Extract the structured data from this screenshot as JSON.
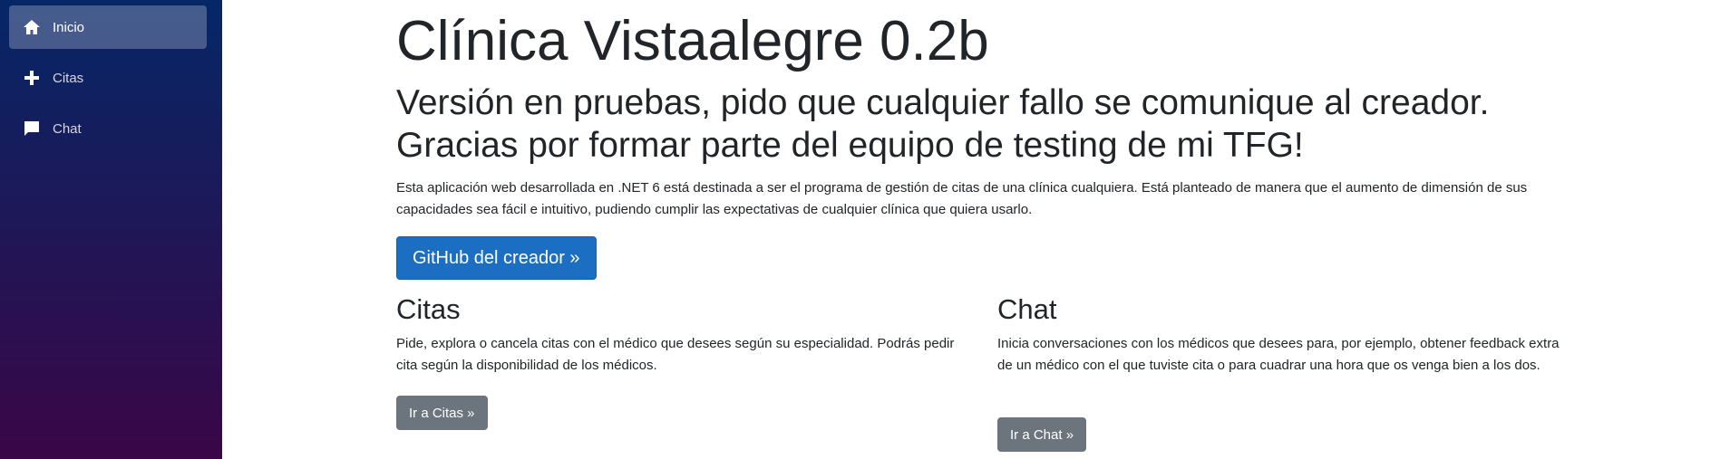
{
  "sidebar": {
    "items": [
      {
        "label": "Inicio",
        "icon": "home-icon",
        "active": true
      },
      {
        "label": "Citas",
        "icon": "plus-icon",
        "active": false
      },
      {
        "label": "Chat",
        "icon": "chat-icon",
        "active": false
      }
    ],
    "gradient": [
      "#052767",
      "#3a0647"
    ]
  },
  "main": {
    "title": "Clínica Vistaalegre 0.2b",
    "lead": "Versión en pruebas, pido que cualquier fallo se comunique al creador. Gracias por formar parte del equipo de testing de mi TFG!",
    "description": "Esta aplicación web desarrollada en .NET 6 está destinada a ser el programa de gestión de citas de una clínica cualquiera. Está planteado de manera que el aumento de dimensión de sus capacidades sea fácil e intuitivo, pudiendo cumplir las expectativas de cualquier clínica que quiera usarlo.",
    "github_button": "GitHub del creador »",
    "citas": {
      "heading": "Citas",
      "text": "Pide, explora o cancela citas con el médico que desees según su especialidad. Podrás pedir cita según la disponibilidad de los médicos.",
      "button": "Ir a Citas »"
    },
    "chat": {
      "heading": "Chat",
      "text": "Inicia conversaciones con los médicos que desees para, por ejemplo, obtener feedback extra de un médico con el que tuviste cita o para cuadrar una hora que os venga bien a los dos.",
      "button": "Ir a Chat »"
    }
  },
  "colors": {
    "primary_button": "#1b6ec2",
    "secondary_button": "#6c757d",
    "text": "#212529"
  }
}
